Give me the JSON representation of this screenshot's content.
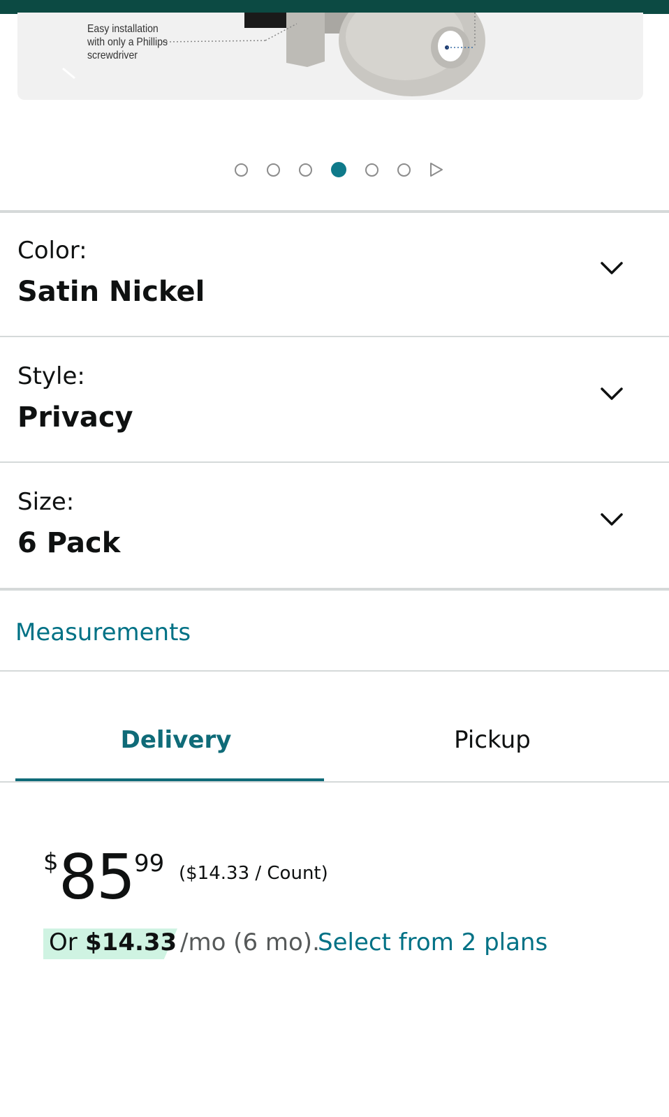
{
  "product_image": {
    "caption_lines": [
      "Easy installation",
      "with only a Phillips",
      "screwdriver"
    ]
  },
  "carousel": {
    "dots": 6,
    "active_index": 3,
    "next_icon": "play-triangle-icon"
  },
  "options": [
    {
      "label": "Color:",
      "value": "Satin Nickel",
      "icon": "chevron-down-icon"
    },
    {
      "label": "Style:",
      "value": "Privacy",
      "icon": "chevron-down-icon"
    },
    {
      "label": "Size:",
      "value": "6 Pack",
      "icon": "chevron-down-icon"
    }
  ],
  "measurements": {
    "link_label": "Measurements"
  },
  "tabs": [
    {
      "label": "Delivery",
      "selected": true
    },
    {
      "label": "Pickup",
      "selected": false
    }
  ],
  "price": {
    "symbol": "$",
    "whole": "85",
    "fraction": "99",
    "unit_price": "($14.33 / Count)"
  },
  "financing": {
    "prefix": "Or",
    "amount": "$14.33",
    "term": "/mo (6 mo).",
    "link_label": "Select from 2 plans"
  },
  "colors": {
    "top_bar": "#0c4a43",
    "accent_teal": "#007185",
    "tab_active": "#0f6b78",
    "highlight": "#cff3e2",
    "divider": "#d5d9d9"
  }
}
